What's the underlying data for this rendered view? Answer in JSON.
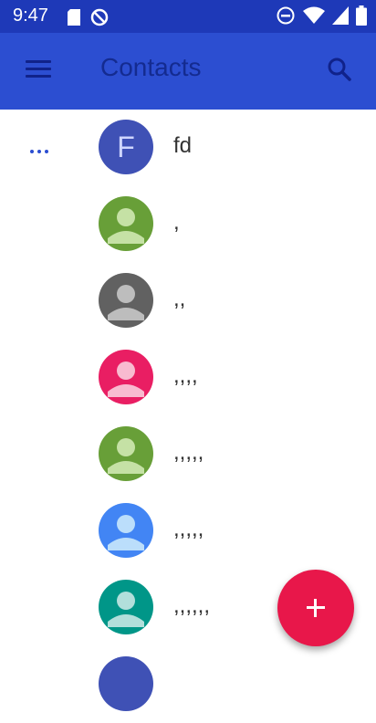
{
  "status_bar": {
    "time": "9:47",
    "left_icons": [
      "sd-card-icon",
      "sync-icon"
    ],
    "right_icons": [
      "do-not-disturb-icon",
      "wifi-icon",
      "cell-signal-icon",
      "battery-icon"
    ]
  },
  "app_bar": {
    "title": "Contacts",
    "menu_icon": "hamburger-menu-icon",
    "search_icon": "search-icon",
    "background": "#2c4ed1",
    "status_background": "#1e39b8"
  },
  "contacts": [
    {
      "name": "fd",
      "avatar_letter": "F",
      "avatar_color": "#3f51b5"
    },
    {
      "name": ",",
      "avatar_letter": "",
      "avatar_color": "#689f38"
    },
    {
      "name": ",,",
      "avatar_letter": "",
      "avatar_color": "#616161"
    },
    {
      "name": ",,,,",
      "avatar_letter": "",
      "avatar_color": "#e91e63"
    },
    {
      "name": ",,,,,",
      "avatar_letter": "",
      "avatar_color": "#689f38"
    },
    {
      "name": ",,,,,",
      "avatar_letter": "",
      "avatar_color": "#4285f4"
    },
    {
      "name": ",,,,,,",
      "avatar_letter": "",
      "avatar_color": "#009688"
    },
    {
      "name": "",
      "avatar_letter": "",
      "avatar_color": "#3f51b5"
    }
  ],
  "fab": {
    "icon": "add-icon",
    "color": "#e8174a"
  },
  "overflow_icon": "more-horiz-icon"
}
